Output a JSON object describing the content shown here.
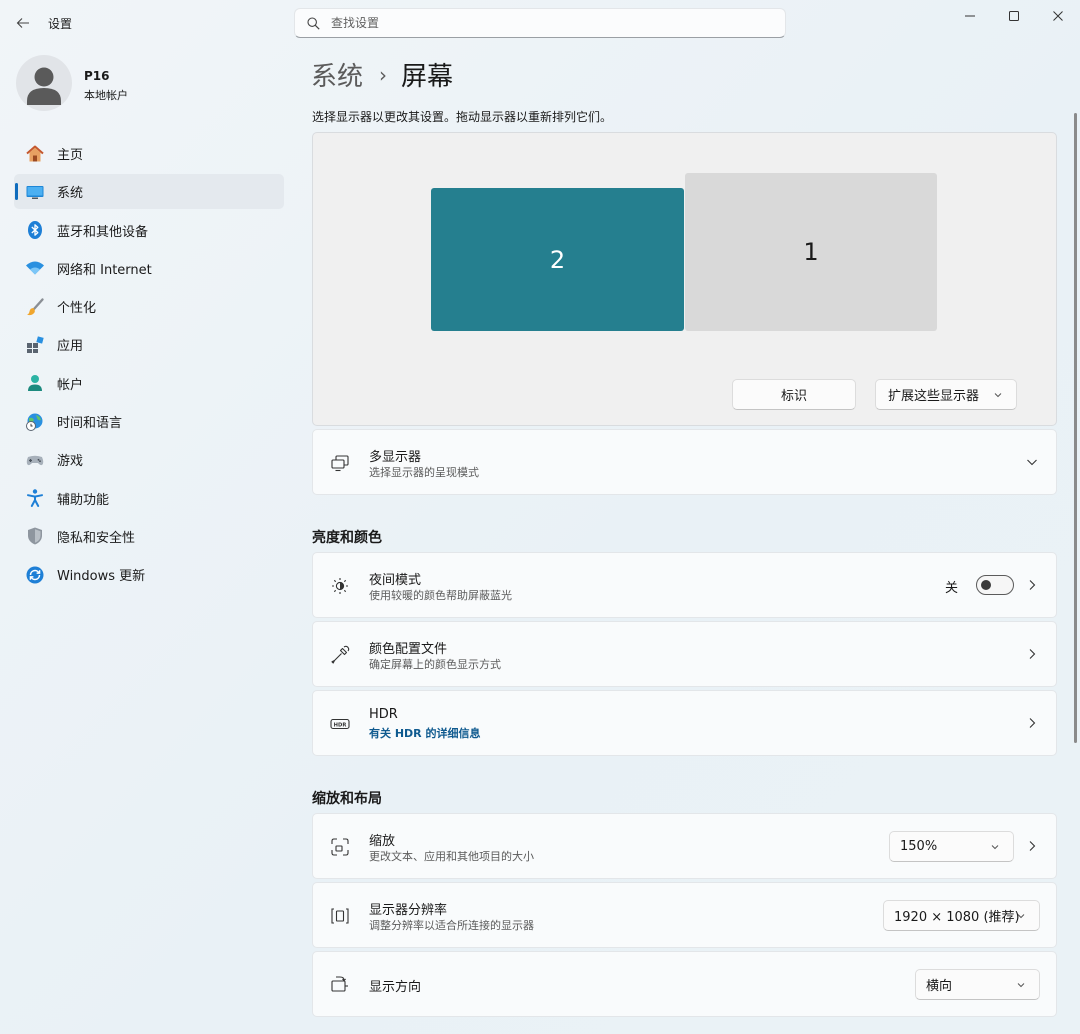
{
  "window": {
    "title": "设置",
    "controls": [
      "minimize",
      "maximize",
      "close"
    ]
  },
  "search": {
    "placeholder": "查找设置"
  },
  "user": {
    "name": "P16",
    "account_type": "本地帐户"
  },
  "sidebar": {
    "items": [
      {
        "label": "主页",
        "icon": "home-icon",
        "active": false
      },
      {
        "label": "系统",
        "icon": "system-display-icon",
        "active": true
      },
      {
        "label": "蓝牙和其他设备",
        "icon": "bluetooth-icon",
        "active": false
      },
      {
        "label": "网络和 Internet",
        "icon": "wifi-icon",
        "active": false
      },
      {
        "label": "个性化",
        "icon": "brush-icon",
        "active": false
      },
      {
        "label": "应用",
        "icon": "apps-icon",
        "active": false
      },
      {
        "label": "帐户",
        "icon": "account-icon",
        "active": false
      },
      {
        "label": "时间和语言",
        "icon": "globe-clock-icon",
        "active": false
      },
      {
        "label": "游戏",
        "icon": "gamepad-icon",
        "active": false
      },
      {
        "label": "辅助功能",
        "icon": "accessibility-icon",
        "active": false
      },
      {
        "label": "隐私和安全性",
        "icon": "shield-icon",
        "active": false
      },
      {
        "label": "Windows 更新",
        "icon": "update-icon",
        "active": false
      }
    ]
  },
  "main": {
    "breadcrumb": {
      "parent": "系统",
      "separator": "›",
      "current": "屏幕"
    },
    "subtitle": "选择显示器以更改其设置。拖动显示器以重新排列它们。",
    "monitors": [
      {
        "label": "2",
        "selected": true,
        "color": "#257f8f"
      },
      {
        "label": "1",
        "selected": false,
        "color": "#d9d9d9"
      }
    ],
    "identify_label": "标识",
    "extend_label": "扩展这些显示器",
    "multi_display": {
      "title": "多显示器",
      "subtitle": "选择显示器的呈现模式"
    },
    "brightness_section": "亮度和颜色",
    "night_light": {
      "title": "夜间模式",
      "subtitle": "使用较暖的颜色帮助屏蔽蓝光",
      "state_label": "关",
      "on": false
    },
    "color_profile": {
      "title": "颜色配置文件",
      "subtitle": "确定屏幕上的颜色显示方式"
    },
    "hdr": {
      "title": "HDR",
      "link": "有关 HDR 的详细信息"
    },
    "scale_section": "缩放和布局",
    "scale": {
      "title": "缩放",
      "subtitle": "更改文本、应用和其他项目的大小",
      "value": "150%"
    },
    "resolution": {
      "title": "显示器分辨率",
      "subtitle": "调整分辨率以适合所连接的显示器",
      "value": "1920 × 1080 (推荐)"
    },
    "orientation": {
      "title": "显示方向",
      "value": "横向"
    }
  },
  "colors": {
    "accent": "#0f6cbd",
    "selected_monitor": "#257f8f",
    "link": "#0f5a8f"
  }
}
